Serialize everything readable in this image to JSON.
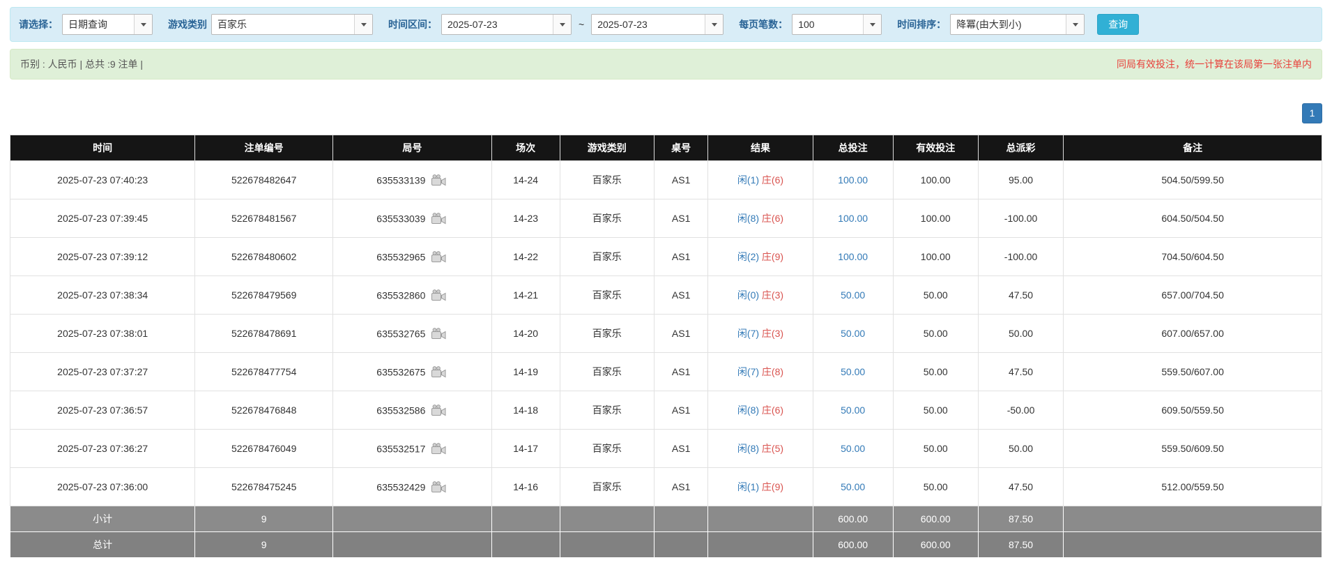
{
  "filters": {
    "select_label": "请选择：",
    "select_value": "日期查询",
    "game_type_label": "游戏类别",
    "game_type_value": "百家乐",
    "date_range_label": "时间区间：",
    "date_from": "2025-07-23",
    "range_separator": "~",
    "date_to": "2025-07-23",
    "page_size_label": "每页笔数：",
    "page_size_value": "100",
    "sort_label": "时间排序：",
    "sort_value": "降冪(由大到小)",
    "search_button": "查询"
  },
  "summary": {
    "info": "币别 : 人民币 | 总共 :9 注单 |",
    "note": "同局有效投注，统一计算在该局第一张注单内"
  },
  "pagination": {
    "current_page": "1"
  },
  "table": {
    "headers": [
      "时间",
      "注单编号",
      "局号",
      "场次",
      "游戏类别",
      "桌号",
      "结果",
      "总投注",
      "有效投注",
      "总派彩",
      "备注"
    ],
    "rows": [
      {
        "time": "2025-07-23 07:40:23",
        "bet_id": "522678482647",
        "round_id": "635533139",
        "session": "14-24",
        "game": "百家乐",
        "table": "AS1",
        "result_player": "闲(1)",
        "result_banker": "庄(6)",
        "total_bet": "100.00",
        "valid_bet": "100.00",
        "payout": "95.00",
        "payout_negative": false,
        "note": "504.50/599.50"
      },
      {
        "time": "2025-07-23 07:39:45",
        "bet_id": "522678481567",
        "round_id": "635533039",
        "session": "14-23",
        "game": "百家乐",
        "table": "AS1",
        "result_player": "闲(8)",
        "result_banker": "庄(6)",
        "total_bet": "100.00",
        "valid_bet": "100.00",
        "payout": "-100.00",
        "payout_negative": true,
        "note": "604.50/504.50"
      },
      {
        "time": "2025-07-23 07:39:12",
        "bet_id": "522678480602",
        "round_id": "635532965",
        "session": "14-22",
        "game": "百家乐",
        "table": "AS1",
        "result_player": "闲(2)",
        "result_banker": "庄(9)",
        "total_bet": "100.00",
        "valid_bet": "100.00",
        "payout": "-100.00",
        "payout_negative": true,
        "note": "704.50/604.50"
      },
      {
        "time": "2025-07-23 07:38:34",
        "bet_id": "522678479569",
        "round_id": "635532860",
        "session": "14-21",
        "game": "百家乐",
        "table": "AS1",
        "result_player": "闲(0)",
        "result_banker": "庄(3)",
        "total_bet": "50.00",
        "valid_bet": "50.00",
        "payout": "47.50",
        "payout_negative": false,
        "note": "657.00/704.50"
      },
      {
        "time": "2025-07-23 07:38:01",
        "bet_id": "522678478691",
        "round_id": "635532765",
        "session": "14-20",
        "game": "百家乐",
        "table": "AS1",
        "result_player": "闲(7)",
        "result_banker": "庄(3)",
        "total_bet": "50.00",
        "valid_bet": "50.00",
        "payout": "50.00",
        "payout_negative": false,
        "note": "607.00/657.00"
      },
      {
        "time": "2025-07-23 07:37:27",
        "bet_id": "522678477754",
        "round_id": "635532675",
        "session": "14-19",
        "game": "百家乐",
        "table": "AS1",
        "result_player": "闲(7)",
        "result_banker": "庄(8)",
        "total_bet": "50.00",
        "valid_bet": "50.00",
        "payout": "47.50",
        "payout_negative": false,
        "note": "559.50/607.00"
      },
      {
        "time": "2025-07-23 07:36:57",
        "bet_id": "522678476848",
        "round_id": "635532586",
        "session": "14-18",
        "game": "百家乐",
        "table": "AS1",
        "result_player": "闲(8)",
        "result_banker": "庄(6)",
        "total_bet": "50.00",
        "valid_bet": "50.00",
        "payout": "-50.00",
        "payout_negative": true,
        "note": "609.50/559.50"
      },
      {
        "time": "2025-07-23 07:36:27",
        "bet_id": "522678476049",
        "round_id": "635532517",
        "session": "14-17",
        "game": "百家乐",
        "table": "AS1",
        "result_player": "闲(8)",
        "result_banker": "庄(5)",
        "total_bet": "50.00",
        "valid_bet": "50.00",
        "payout": "50.00",
        "payout_negative": false,
        "note": "559.50/609.50"
      },
      {
        "time": "2025-07-23 07:36:00",
        "bet_id": "522678475245",
        "round_id": "635532429",
        "session": "14-16",
        "game": "百家乐",
        "table": "AS1",
        "result_player": "闲(1)",
        "result_banker": "庄(9)",
        "total_bet": "50.00",
        "valid_bet": "50.00",
        "payout": "47.50",
        "payout_negative": false,
        "note": "512.00/559.50"
      }
    ],
    "footer": [
      {
        "label": "小计",
        "count": "9",
        "total_bet": "600.00",
        "valid_bet": "600.00",
        "payout": "87.50"
      },
      {
        "label": "总计",
        "count": "9",
        "total_bet": "600.00",
        "valid_bet": "600.00",
        "payout": "87.50"
      }
    ]
  },
  "colors": {
    "accent_blue": "#337ab7",
    "banker_red": "#d9534f",
    "negative_red": "#e03131",
    "search_button_bg": "#31b0d5",
    "filter_bar_bg": "#d9edf7",
    "summary_bar_bg": "#dff0d8",
    "table_header_bg": "#151515",
    "footer_row_bg": "#8b8b8b"
  }
}
